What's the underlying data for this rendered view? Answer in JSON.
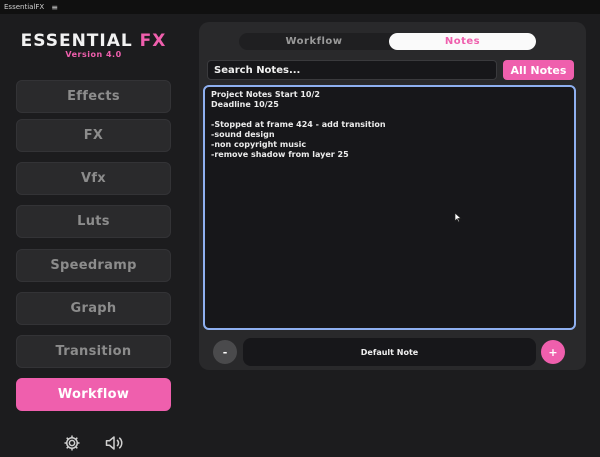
{
  "window": {
    "title": "EssentialFX"
  },
  "brand": {
    "name_main": "ESSENTIAL",
    "name_accent": "FX",
    "version": "Version 4.0"
  },
  "sidebar": {
    "items": [
      {
        "label": "Effects"
      },
      {
        "label": "FX"
      },
      {
        "label": "Vfx"
      },
      {
        "label": "Luts"
      },
      {
        "label": "Speedramp"
      },
      {
        "label": "Graph"
      },
      {
        "label": "Transition"
      },
      {
        "label": "Workflow",
        "active": true
      }
    ],
    "footer_icons": [
      "gear-icon",
      "speaker-icon"
    ]
  },
  "tabs": [
    {
      "label": "Workflow"
    },
    {
      "label": "Notes",
      "active": true
    }
  ],
  "search": {
    "placeholder": "Search Notes..."
  },
  "all_notes_label": "All Notes",
  "notes": {
    "lines": [
      "Project Notes Start 10/2",
      "Deadline 10/25",
      "",
      "-Stopped at frame 424 - add transition",
      "-sound design",
      "-non copyright music",
      "-remove shadow from layer 25"
    ]
  },
  "bottom_bar": {
    "minus_label": "-",
    "note_name": "Default Note",
    "plus_label": "+"
  },
  "colors": {
    "accent": "#ef5fad",
    "focus_border": "#8fb0f0",
    "background": "#1c1c1e"
  }
}
